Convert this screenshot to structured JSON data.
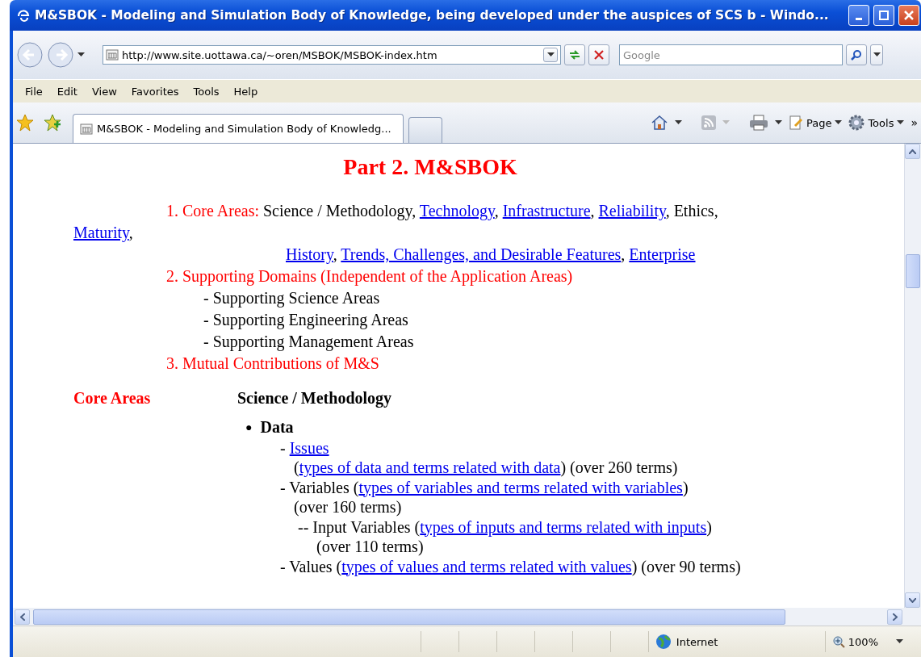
{
  "window": {
    "title": "M&SBOK - Modeling and Simulation Body of Knowledge, being developed under the auspices of SCS b - Windo..."
  },
  "address_bar": {
    "url": "http://www.site.uottawa.ca/~oren/MSBOK/MSBOK-index.htm"
  },
  "search": {
    "placeholder": "Google"
  },
  "menu": [
    "File",
    "Edit",
    "View",
    "Favorites",
    "Tools",
    "Help"
  ],
  "tabs": [
    {
      "label": "M&SBOK - Modeling and Simulation Body of Knowledg...",
      "selected": true
    }
  ],
  "command_bar": {
    "page": "Page",
    "tools": "Tools",
    "more": "»"
  },
  "page": {
    "heading": "Part 2. M&SBOK",
    "outline": [
      {
        "kind": "item",
        "segments": [
          {
            "kind": "label",
            "text": "1. Core Areas: "
          },
          {
            "kind": "text",
            "text": "Science / Methodology, "
          },
          {
            "kind": "link",
            "text": "Technology"
          },
          {
            "kind": "text",
            "text": ", "
          },
          {
            "kind": "link",
            "text": "Infrastructure"
          },
          {
            "kind": "text",
            "text": ", "
          },
          {
            "kind": "link",
            "text": "Reliability"
          },
          {
            "kind": "text",
            "text": ", Ethics,"
          }
        ]
      },
      {
        "kind": "wrap",
        "segments": [
          {
            "kind": "link",
            "text": "Maturity"
          },
          {
            "kind": "text",
            "text": ","
          }
        ]
      },
      {
        "kind": "continuation",
        "segments": [
          {
            "kind": "link",
            "text": "History"
          },
          {
            "kind": "text",
            "text": ", "
          },
          {
            "kind": "link",
            "text": "Trends, Challenges, and Desirable Features"
          },
          {
            "kind": "text",
            "text": ", "
          },
          {
            "kind": "link",
            "text": "Enterprise"
          }
        ]
      },
      {
        "kind": "item",
        "segments": [
          {
            "kind": "label",
            "text": "2. Supporting Domains (Independent of the Application Areas)"
          }
        ]
      },
      {
        "kind": "sub",
        "segments": [
          {
            "kind": "text",
            "text": "- Supporting Science Areas"
          }
        ]
      },
      {
        "kind": "sub",
        "segments": [
          {
            "kind": "text",
            "text": "- Supporting Engineering Areas"
          }
        ]
      },
      {
        "kind": "sub",
        "segments": [
          {
            "kind": "text",
            "text": "- Supporting Management Areas"
          }
        ]
      },
      {
        "kind": "item",
        "segments": [
          {
            "kind": "label",
            "text": "3. Mutual Contributions of M&S"
          }
        ]
      }
    ],
    "section": {
      "label": "Core Areas",
      "title": "Science / Methodology"
    },
    "entries": [
      {
        "kind": "bullet",
        "marker": "●",
        "segments": [
          {
            "kind": "text",
            "text": "Data"
          }
        ]
      },
      {
        "kind": "entry",
        "segments": [
          {
            "kind": "text",
            "text": "- "
          },
          {
            "kind": "link",
            "text": "Issues"
          }
        ]
      },
      {
        "kind": "note",
        "segments": [
          {
            "kind": "text",
            "text": "("
          },
          {
            "kind": "link",
            "text": "types of data and terms related with data"
          },
          {
            "kind": "text",
            "text": ") (over 260 terms)"
          }
        ]
      },
      {
        "kind": "entry",
        "segments": [
          {
            "kind": "text",
            "text": "- Variables ("
          },
          {
            "kind": "link",
            "text": "types of variables and terms related with variables"
          },
          {
            "kind": "text",
            "text": ")"
          }
        ]
      },
      {
        "kind": "note",
        "segments": [
          {
            "kind": "text",
            "text": "(over 160 terms)"
          }
        ]
      },
      {
        "kind": "sub-entry",
        "segments": [
          {
            "kind": "text",
            "text": "-- Input Variables ("
          },
          {
            "kind": "link",
            "text": "types of inputs and terms related with inputs"
          },
          {
            "kind": "text",
            "text": ")"
          }
        ]
      },
      {
        "kind": "sub-note",
        "segments": [
          {
            "kind": "text",
            "text": "(over 110 terms)"
          }
        ]
      },
      {
        "kind": "entry",
        "segments": [
          {
            "kind": "text",
            "text": "- Values ("
          },
          {
            "kind": "link",
            "text": "types of values and terms related with values"
          },
          {
            "kind": "text",
            "text": ") (over 90 terms)"
          }
        ]
      }
    ]
  },
  "status_bar": {
    "zone": "Internet",
    "zoom": "100%"
  }
}
